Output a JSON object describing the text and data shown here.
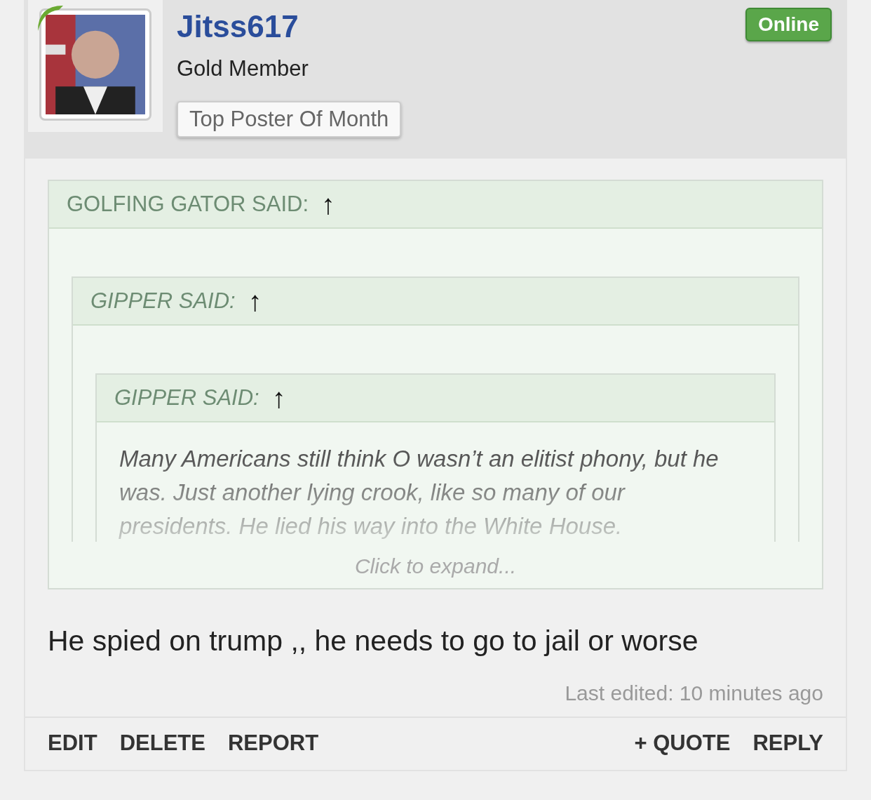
{
  "user": {
    "name": "Jitss617",
    "rank": "Gold Member",
    "banner": "Top Poster Of Month",
    "status": "Online"
  },
  "quote": {
    "author": "GOLFING GATOR SAID:",
    "arrow": "↑",
    "italic": false,
    "expand": "Click to expand...",
    "quote": {
      "author": "GIPPER SAID:",
      "arrow": "↑",
      "italic": true,
      "quote": {
        "author": "GIPPER SAID:",
        "arrow": "↑",
        "italic": true,
        "text": "Many Americans still think O wasn’t an elitist phony, but he was. Just another lying crook, like so many of our presidents. He lied his way into the White House."
      }
    }
  },
  "message": "He spied on trump ,, he needs to go to jail or worse",
  "last_edited": "Last edited: 10 minutes ago",
  "actions_left": [
    "EDIT",
    "DELETE",
    "REPORT"
  ],
  "actions_right": [
    "+ QUOTE",
    "REPLY"
  ]
}
